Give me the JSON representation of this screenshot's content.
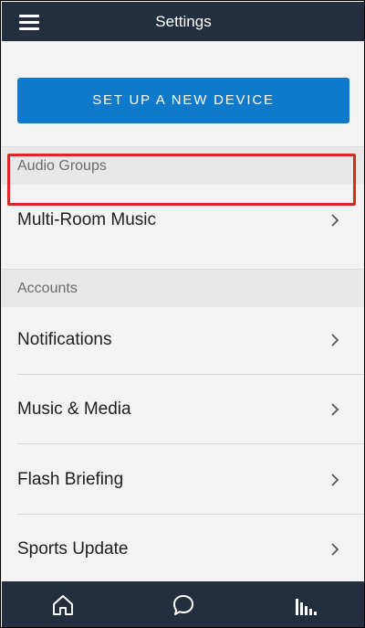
{
  "topbar": {
    "title": "Settings",
    "menu_icon": "hamburger-menu-icon"
  },
  "setup_button": {
    "label": "SET UP A NEW DEVICE",
    "color": "#0f7acb"
  },
  "sections": [
    {
      "header": "Audio Groups",
      "items": [
        {
          "label": "Multi-Room Music",
          "highlighted": true
        }
      ]
    },
    {
      "header": "Accounts",
      "items": [
        {
          "label": "Notifications"
        },
        {
          "label": "Music & Media"
        },
        {
          "label": "Flash Briefing"
        },
        {
          "label": "Sports Update"
        }
      ]
    }
  ],
  "highlight_color": "#d62b25",
  "bottom_nav": [
    {
      "icon": "home-icon"
    },
    {
      "icon": "chat-bubble-icon"
    },
    {
      "icon": "now-playing-bars-icon"
    }
  ],
  "theme": {
    "bar_color": "#232f3e",
    "background": "#f3f3f3"
  }
}
